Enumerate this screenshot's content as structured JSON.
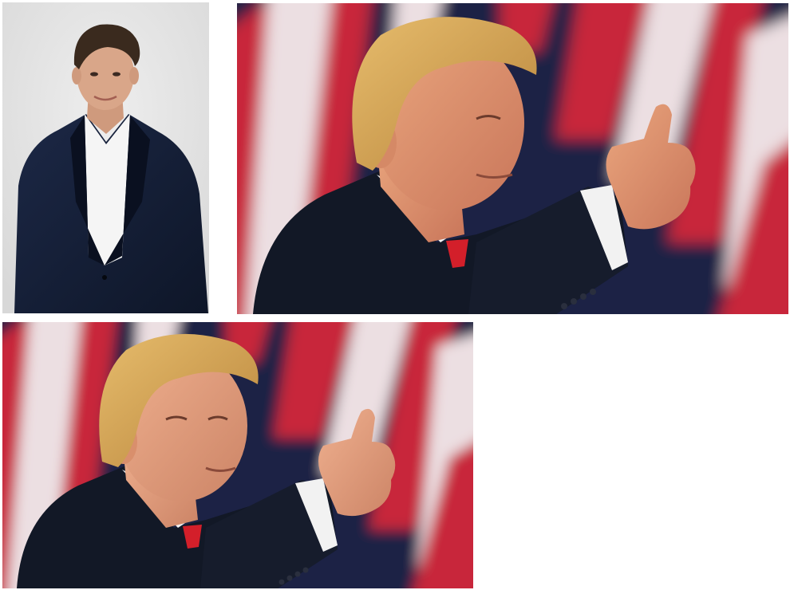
{
  "collage": {
    "background_color": "#ffffff",
    "panels": [
      {
        "id": "panel-a",
        "subject": "portrait-man-dark-suit",
        "background_color": "#e4e4e4",
        "suit_color": "#15203a",
        "shirt_color": "#f7f7f7",
        "hair_color": "#3a2a1e",
        "skin_color": "#d7a487"
      },
      {
        "id": "panel-b",
        "subject": "man-thumbs-up-flag-background",
        "flag_red": "#c8283a",
        "flag_white": "#ecdfe2",
        "flag_blue": "#1c2444",
        "suit_color": "#121826",
        "tie_color": "#d31f2a",
        "hair_color": "#d7a752",
        "skin_color": "#e39a72"
      },
      {
        "id": "panel-c",
        "subject": "man-thumbs-up-flag-background-altered-face",
        "flag_red": "#c8283a",
        "flag_white": "#ecdfe2",
        "flag_blue": "#1c2444",
        "suit_color": "#121826",
        "tie_color": "#d31f2a",
        "hair_color": "#d7a752",
        "skin_color": "#e6a181"
      }
    ]
  }
}
